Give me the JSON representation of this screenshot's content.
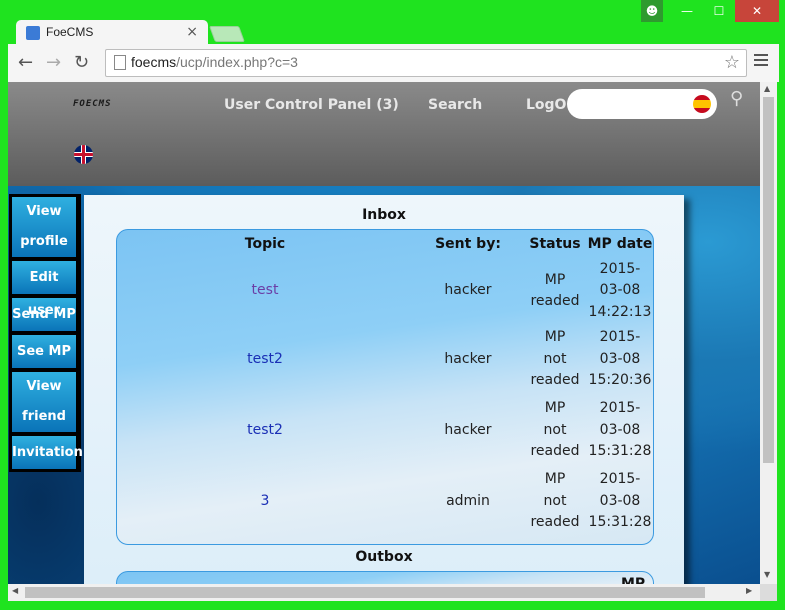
{
  "browser": {
    "tab_title": "FoeCMS",
    "url_domain": "foecms",
    "url_path": "/ucp/index.php?c=3"
  },
  "header": {
    "logo_text": "FOECMS",
    "nav": {
      "ucp": "User Control Panel (3)",
      "search": "Search",
      "logout": "LogOut"
    }
  },
  "sidebar": {
    "items": [
      {
        "label_line1": "View",
        "label_line2": "profile"
      },
      {
        "label": "Edit user"
      },
      {
        "label": "Send MP"
      },
      {
        "label": "See MP"
      },
      {
        "label_line1": "View",
        "label_line2": "friend"
      },
      {
        "label": "Invitation"
      }
    ]
  },
  "inbox": {
    "title": "Inbox",
    "columns": [
      "Topic",
      "Sent by:",
      "Status",
      "MP date"
    ],
    "rows": [
      {
        "topic": "test",
        "sent_by": "hacker",
        "status": [
          "MP",
          "readed"
        ],
        "date": [
          "2015-",
          "03-08",
          "14:22:13"
        ]
      },
      {
        "topic": "test2",
        "sent_by": "hacker",
        "status": [
          "MP",
          "not",
          "readed"
        ],
        "date": [
          "2015-",
          "03-08",
          "15:20:36"
        ]
      },
      {
        "topic": "test2",
        "sent_by": "hacker",
        "status": [
          "MP",
          "not",
          "readed"
        ],
        "date": [
          "2015-",
          "03-08",
          "15:31:28"
        ]
      },
      {
        "topic": "3",
        "sent_by": "admin",
        "status": [
          "MP",
          "not",
          "readed"
        ],
        "date": [
          "2015-",
          "03-08",
          "15:31:28"
        ]
      }
    ]
  },
  "outbox": {
    "title": "Outbox",
    "partial_header": "MP"
  }
}
